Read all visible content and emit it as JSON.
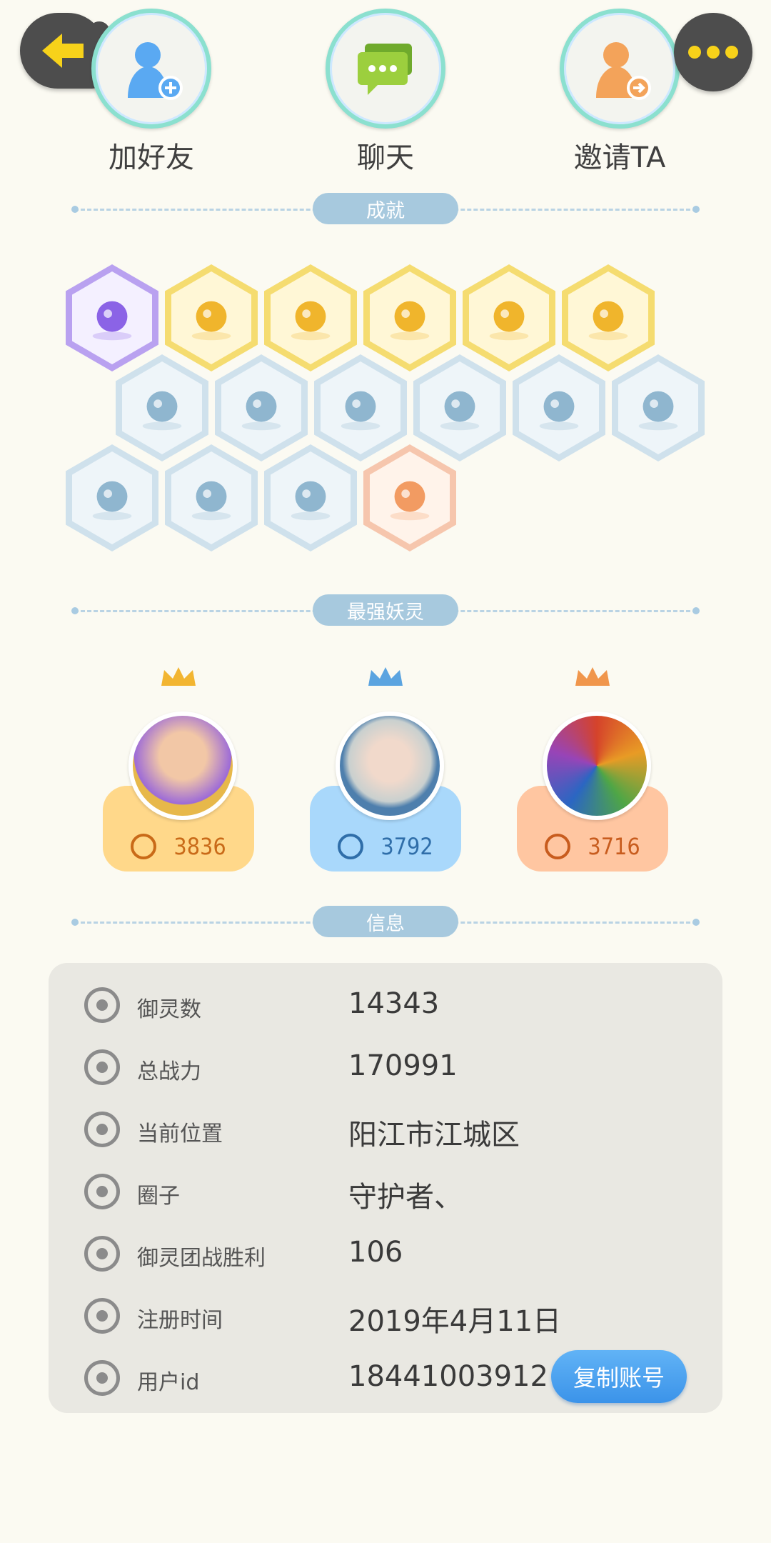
{
  "actions": {
    "add_friend": "加好友",
    "chat": "聊天",
    "invite": "邀请TA"
  },
  "sections": {
    "achievements": "成就",
    "top_spirits": "最强妖灵",
    "info": "信息"
  },
  "achievements": {
    "badges": [
      {
        "color": "purple",
        "icon": "cat-face-icon"
      },
      {
        "color": "gold",
        "icon": "sun-orb-icon"
      },
      {
        "color": "gold",
        "icon": "golden-ball-icon"
      },
      {
        "color": "gold",
        "icon": "yin-yang-comet-icon"
      },
      {
        "color": "gold",
        "icon": "yin-yang-card-icon"
      },
      {
        "color": "gold",
        "icon": "open-book-icon"
      },
      {
        "color": "blue",
        "icon": "shoe-icon"
      },
      {
        "color": "blue",
        "icon": "moon-icon"
      },
      {
        "color": "blue",
        "icon": "crystal-icon"
      },
      {
        "color": "blue",
        "icon": "spirit-figure-icon"
      },
      {
        "color": "blue",
        "icon": "cat-spirit-icon"
      },
      {
        "color": "blue",
        "icon": "dragon-icon"
      },
      {
        "color": "blue",
        "icon": "shield-icon"
      },
      {
        "color": "blue",
        "icon": "horned-spirit-icon"
      },
      {
        "color": "blue",
        "icon": "bird-spirit-icon"
      },
      {
        "color": "peach",
        "icon": "stroller-cat-icon"
      }
    ]
  },
  "top_spirits": [
    {
      "power": "3836",
      "rank": "gold"
    },
    {
      "power": "3792",
      "rank": "blue"
    },
    {
      "power": "3716",
      "rank": "orange"
    }
  ],
  "info": {
    "rows": [
      {
        "label": "御灵数",
        "value": "14343",
        "icon": "spirit-count-icon"
      },
      {
        "label": "总战力",
        "value": "170991",
        "icon": "combat-power-icon"
      },
      {
        "label": "当前位置",
        "value": "阳江市江城区",
        "icon": "location-icon"
      },
      {
        "label": "圈子",
        "value": "守护者、",
        "icon": "circle-group-icon"
      },
      {
        "label": "御灵团战胜利",
        "value": "106",
        "icon": "team-battle-icon"
      },
      {
        "label": "注册时间",
        "value": "2019年4月11日",
        "icon": "clock-icon"
      },
      {
        "label": "用户id",
        "value": "18441003912",
        "icon": "user-id-icon"
      }
    ],
    "copy_button": "复制账号"
  },
  "colors": {
    "background": "#fbfaf2",
    "accent_blue": "#3b93e9",
    "section_pill": "#a7c9de"
  }
}
